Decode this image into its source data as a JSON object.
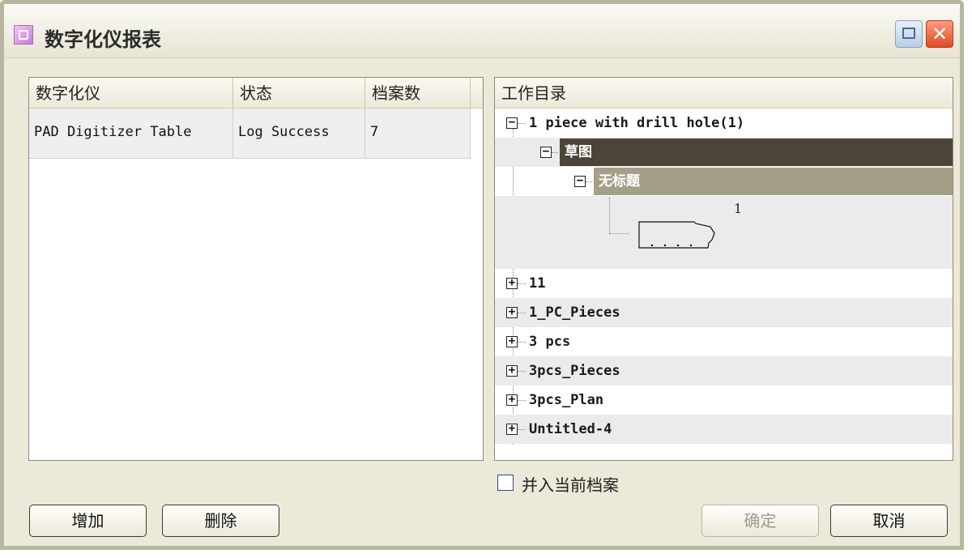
{
  "window": {
    "title": "数字化仪报表",
    "icon": "digitizer-app-icon",
    "maximize_icon": "maximize-icon",
    "close_glyph": "✕"
  },
  "left_table": {
    "columns": [
      "数字化仪",
      "状态",
      "档案数"
    ],
    "rows": [
      {
        "digitizer": "PAD Digitizer Table",
        "status": "Log Success",
        "count": "7"
      }
    ]
  },
  "right_tree": {
    "header": "工作目录",
    "items": [
      {
        "label": "1 piece with drill hole(1)",
        "expanded": true
      },
      {
        "label": "草图",
        "expanded": true,
        "selected": "dark"
      },
      {
        "label": "无标题",
        "expanded": true,
        "selected": "mid"
      },
      {
        "label": "1",
        "type": "piece-thumbnail"
      },
      {
        "label": "11",
        "expanded": false
      },
      {
        "label": "1_PC_Pieces",
        "expanded": false
      },
      {
        "label": "3 pcs",
        "expanded": false
      },
      {
        "label": "3pcs_Pieces",
        "expanded": false
      },
      {
        "label": "3pcs_Plan",
        "expanded": false
      },
      {
        "label": "Untitled-4",
        "expanded": false
      }
    ]
  },
  "merge_checkbox": {
    "label": "并入当前档案",
    "checked": false
  },
  "buttons": {
    "add": "增加",
    "delete": "删除",
    "ok": "确定",
    "cancel": "取消"
  },
  "colors": {
    "dialog_bg": "#ECE9D8",
    "selection_dark": "#4B4538",
    "selection_mid": "#A59F88",
    "close_red": "#E04B26"
  }
}
